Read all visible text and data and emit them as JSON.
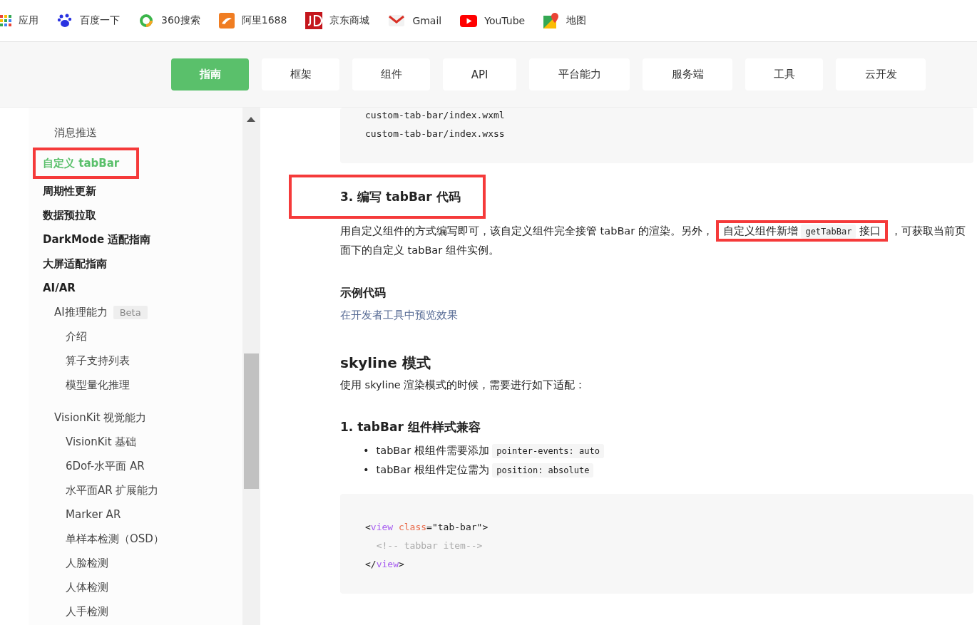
{
  "bookmarks": [
    {
      "kind": "apps",
      "label": "应用"
    },
    {
      "kind": "paw",
      "label": "百度一下"
    },
    {
      "kind": "ring",
      "label": "360搜索"
    },
    {
      "kind": "ali",
      "label": "阿里1688"
    },
    {
      "kind": "jd",
      "label": "京东商城"
    },
    {
      "kind": "mail",
      "label": "Gmail"
    },
    {
      "kind": "video",
      "label": "YouTube"
    },
    {
      "kind": "map",
      "label": "地图"
    }
  ],
  "nav": [
    {
      "label": "指南",
      "selected": true
    },
    {
      "label": "框架",
      "selected": false
    },
    {
      "label": "组件",
      "selected": false
    },
    {
      "label": "API",
      "selected": false
    },
    {
      "label": "平台能力",
      "selected": false
    },
    {
      "label": "服务端",
      "selected": false
    },
    {
      "label": "工具",
      "selected": false
    },
    {
      "label": "云开发",
      "selected": false
    }
  ],
  "sidebar": {
    "items": [
      {
        "children": [
          {
            "label": "消息推送",
            "selected": false,
            "highlighted": false
          }
        ]
      },
      {
        "label": "自定义 tabBar",
        "selected": true,
        "highlighted": true
      },
      {
        "label": "周期性更新",
        "selected": false,
        "highlighted": false
      },
      {
        "label": "数据预拉取",
        "selected": false,
        "highlighted": false
      },
      {
        "label": "DarkMode 适配指南",
        "selected": false,
        "highlighted": false
      },
      {
        "label": "大屏适配指南",
        "selected": false,
        "highlighted": false
      },
      {
        "label": "AI/AR",
        "selected": false,
        "highlighted": false,
        "children": [
          {
            "label": "AI推理能力",
            "badge": "Beta",
            "selected": false,
            "highlighted": false,
            "children": [
              {
                "label": "介绍",
                "selected": false,
                "highlighted": false
              },
              {
                "label": "算子支持列表",
                "selected": false,
                "highlighted": false
              },
              {
                "label": "模型量化推理",
                "selected": false,
                "highlighted": false
              }
            ]
          },
          {
            "label": "VisionKit 视觉能力",
            "selected": false,
            "highlighted": false,
            "children": [
              {
                "label": "VisionKit 基础",
                "selected": false,
                "highlighted": false
              },
              {
                "label": "6Dof-水平面 AR",
                "selected": false,
                "highlighted": false
              },
              {
                "label": "水平面AR 扩展能力",
                "selected": false,
                "highlighted": false
              },
              {
                "label": "Marker AR",
                "selected": false,
                "highlighted": false
              },
              {
                "label": "单样本检测（OSD）",
                "selected": false,
                "highlighted": false
              },
              {
                "label": "人脸检测",
                "selected": false,
                "highlighted": false
              },
              {
                "label": "人体检测",
                "selected": false,
                "highlighted": false
              },
              {
                "label": "人手检测",
                "selected": false,
                "highlighted": false
              }
            ]
          }
        ]
      }
    ]
  },
  "content": [
    {
      "kind": "code",
      "lines": [
        [
          {
            "kind": "plain",
            "text": "custom-tab-bar/index.wxml"
          }
        ],
        [
          {
            "kind": "plain",
            "text": "custom-tab-bar/index.wxss"
          }
        ]
      ]
    },
    {
      "kind": "h3",
      "text": "3. 编写 tabBar 代码",
      "highlighted": true
    },
    {
      "kind": "para",
      "parts": [
        {
          "kind": "text",
          "text": "用自定义组件的方式编写即可，该自定义组件完全接管 tabBar 的渲染。另外，"
        },
        {
          "kind": "mark",
          "parts": [
            {
              "kind": "text",
              "text": "自定义组件新增 "
            },
            {
              "kind": "code",
              "text": "getTabBar"
            },
            {
              "kind": "text",
              "text": " 接口"
            }
          ]
        },
        {
          "kind": "text",
          "text": "，可获取当前页面下的自定义 tabBar 组件实例。"
        }
      ]
    },
    {
      "kind": "h4",
      "text": "示例代码"
    },
    {
      "kind": "link",
      "text": "在开发者工具中预览效果"
    },
    {
      "kind": "h2",
      "text": "skyline 模式"
    },
    {
      "kind": "para",
      "parts": [
        {
          "kind": "text",
          "text": "使用 skyline 渲染模式的时候，需要进行如下适配："
        }
      ]
    },
    {
      "kind": "h3",
      "text": "1. tabBar 组件样式兼容",
      "highlighted": false
    },
    {
      "kind": "bullets",
      "items": [
        {
          "marker": "•",
          "parts": [
            {
              "kind": "text",
              "text": "tabBar 根组件需要添加 "
            },
            {
              "kind": "code",
              "text": "pointer-events: auto"
            }
          ]
        },
        {
          "marker": "•",
          "parts": [
            {
              "kind": "text",
              "text": "tabBar 根组件定位需为 "
            },
            {
              "kind": "code",
              "text": "position: absolute"
            }
          ]
        }
      ]
    },
    {
      "kind": "code",
      "lines": [
        [
          {
            "kind": "punct",
            "text": "<"
          },
          {
            "kind": "tag",
            "text": "view"
          },
          {
            "kind": "attr",
            "text": " class"
          },
          {
            "kind": "punct",
            "text": "=\"tab-bar\">"
          }
        ],
        [
          {
            "kind": "comment",
            "text": "  <!-- tabbar item-->"
          }
        ],
        [
          {
            "kind": "punct",
            "text": "</"
          },
          {
            "kind": "tag",
            "text": "view"
          },
          {
            "kind": "punct",
            "text": ">"
          }
        ]
      ]
    }
  ]
}
